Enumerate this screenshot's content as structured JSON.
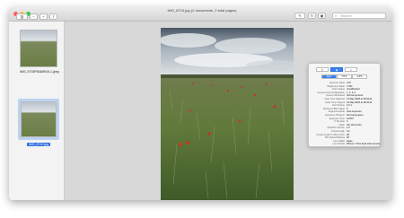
{
  "window": {
    "title": "IMG_8719.jpg (2 documents, 2 total pages)"
  },
  "toolbar": {
    "search_placeholder": "Search"
  },
  "sidebar": {
    "items": [
      {
        "label": "IMG_5703FB4A8916-1.jpeg",
        "selected": false
      },
      {
        "label": "IMG_8719.jpg",
        "selected": true
      }
    ]
  },
  "inspector": {
    "tabs": [
      "General",
      "Exif",
      "GPS"
    ],
    "subtabs": [
      "Exif",
      "TIFF",
      "GPS"
    ],
    "rows": [
      {
        "k": "Aperture Value",
        "v": "3.97"
      },
      {
        "k": "Brightness Value",
        "v": "7.254"
      },
      {
        "k": "Color Space",
        "v": "Uncalibrated"
      },
      {
        "k": "Components Configuration",
        "v": "1, 2, 3, 0"
      },
      {
        "k": "Custom Rendered",
        "v": "Normal process"
      },
      {
        "k": "Date Time Digitized",
        "v": "19 May 2018 at 18:34:11"
      },
      {
        "k": "Date Time Original",
        "v": "19 May 2018 at 18:34:11"
      },
      {
        "k": "Exif Version",
        "v": "2.3.1"
      },
      {
        "k": "Exposure Bias Value",
        "v": "0"
      },
      {
        "k": "Exposure Mode",
        "v": "Auto exposure"
      },
      {
        "k": "Exposure Program",
        "v": "Normal program"
      },
      {
        "k": "Exposure Time",
        "v": "1/1507"
      },
      {
        "k": "F Number",
        "v": "4"
      },
      {
        "k": "Flash",
        "v": "Off, did not fire"
      },
      {
        "k": "FlashPix Version",
        "v": "1.0"
      },
      {
        "k": "Focal Length",
        "v": "4.2"
      },
      {
        "k": "Focal Length In 35mm Film",
        "v": "28"
      },
      {
        "k": "ISO Speed Ratings",
        "v": "20"
      },
      {
        "k": "Lens Make",
        "v": "Apple"
      },
      {
        "k": "Lens Model",
        "v": "iPhone 7 Plus back dual camera"
      }
    ]
  }
}
